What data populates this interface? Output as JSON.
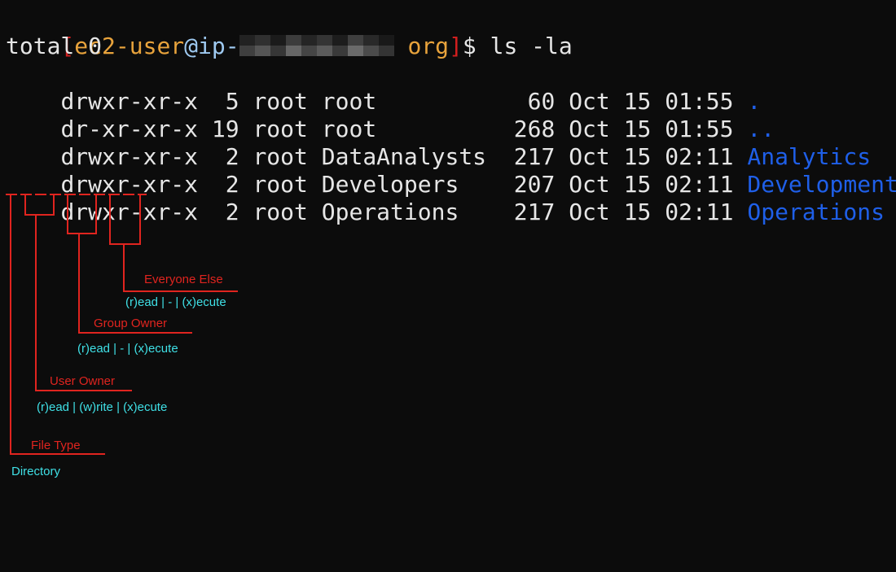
{
  "prompt": {
    "open_bracket": "[",
    "user": "ec2-user",
    "at": "@",
    "host_prefix": "ip-",
    "host_suffix": "org",
    "close_bracket": "]",
    "symbol": "$",
    "command": "ls -la"
  },
  "total_line": "total 0",
  "entries": [
    {
      "perms": "drwxr-xr-x",
      "links": " 5",
      "owner": "root",
      "group": "root        ",
      "size": "  60",
      "date": "Oct 15 01:55",
      "name": "."
    },
    {
      "perms": "dr-xr-xr-x",
      "links": "19",
      "owner": "root",
      "group": "root        ",
      "size": " 268",
      "date": "Oct 15 01:55",
      "name": ".."
    },
    {
      "perms": "drwxr-xr-x",
      "links": " 2",
      "owner": "root",
      "group": "DataAnalysts",
      "size": " 217",
      "date": "Oct 15 02:11",
      "name": "Analytics"
    },
    {
      "perms": "drwxr-xr-x",
      "links": " 2",
      "owner": "root",
      "group": "Developers  ",
      "size": " 207",
      "date": "Oct 15 02:11",
      "name": "Development"
    },
    {
      "perms": "drwxr-xr-x",
      "links": " 2",
      "owner": "root",
      "group": "Operations  ",
      "size": " 217",
      "date": "Oct 15 02:11",
      "name": "Operations"
    }
  ],
  "annotations": {
    "everyone_else": {
      "title": "Everyone Else",
      "desc": "(r)ead | - | (x)ecute"
    },
    "group_owner": {
      "title": "Group Owner",
      "desc": "(r)ead | - | (x)ecute"
    },
    "user_owner": {
      "title": "User Owner",
      "desc": "(r)ead | (w)rite | (x)ecute"
    },
    "file_type": {
      "title": "File Type",
      "desc": "Directory"
    }
  },
  "colors": {
    "background": "#0c0c0c",
    "text": "#e6e6e6",
    "bracket": "#d21f1f",
    "user": "#e8a33c",
    "host": "#9ec9f0",
    "directory": "#1f5fe8",
    "annotation_line": "#e0241f",
    "annotation_desc": "#3fe0e6"
  }
}
